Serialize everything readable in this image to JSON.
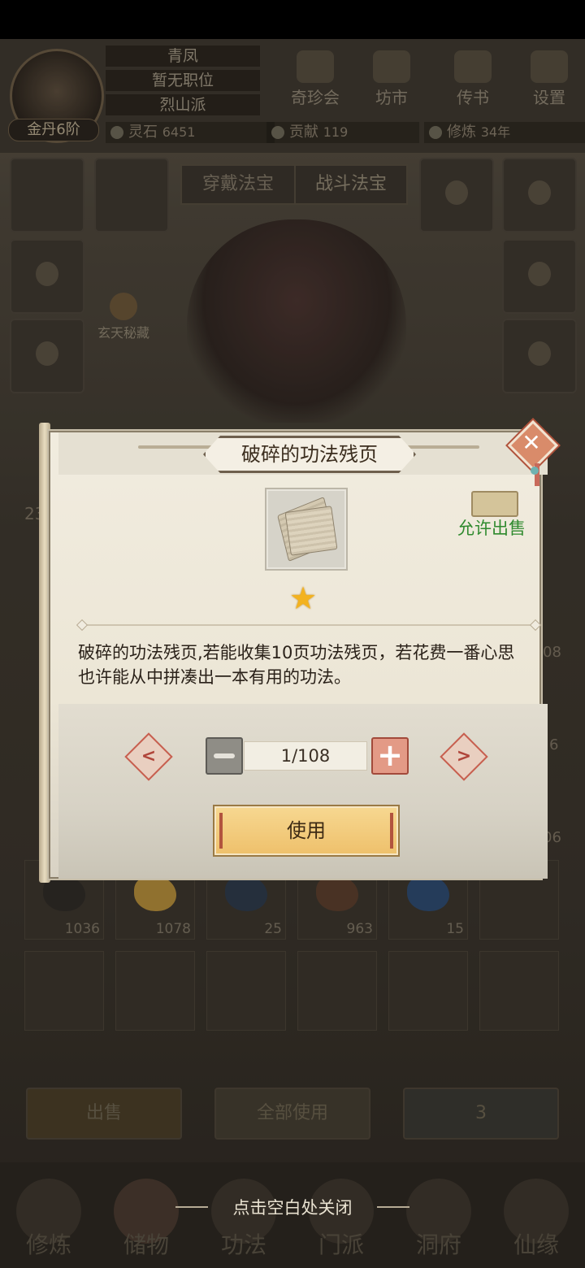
{
  "player": {
    "name": "青凤",
    "position": "暂无职位",
    "sect": "烈山派",
    "rank": "金丹6阶"
  },
  "top_menu": [
    {
      "label": "奇珍会",
      "icon": "treasure-pavilion-icon"
    },
    {
      "label": "坊市",
      "icon": "market-icon"
    },
    {
      "label": "传书",
      "icon": "scroll-letter-icon"
    },
    {
      "label": "设置",
      "icon": "gear-icon"
    }
  ],
  "resources": {
    "spirit_stone_label": "灵石",
    "spirit_stone_value": "6451",
    "contribution_label": "贡献",
    "contribution_value": "119",
    "cultivation_label": "修炼",
    "cultivation_value": "34年"
  },
  "tabs": {
    "wear": "穿戴法宝",
    "battle": "战斗法宝"
  },
  "side_label": "玄天秘藏",
  "inventory_row": [
    {
      "count": "1036",
      "color": "#2f2b27"
    },
    {
      "count": "1078",
      "color": "#b08a3a"
    },
    {
      "count": "25",
      "color": "#2e3a4a"
    },
    {
      "count": "963",
      "color": "#5a3e2c"
    },
    {
      "count": "15",
      "color": "#2e4a6e"
    }
  ],
  "partial_numbers": {
    "left": "23",
    "right_1": "08",
    "right_2": "6",
    "right_3": "06"
  },
  "bottom_buttons": {
    "sell": "出售",
    "use_all": "全部使用",
    "quantity": "3"
  },
  "bottom_nav": [
    {
      "label": "修炼"
    },
    {
      "label": "储物"
    },
    {
      "label": "功法"
    },
    {
      "label": "门派"
    },
    {
      "label": "洞府"
    },
    {
      "label": "仙缘"
    }
  ],
  "modal": {
    "title": "破碎的功法残页",
    "sell_status": "允许出售",
    "description": "破碎的功法残页,若能收集10页功法残页，若花费一番心思也许能从中拼凑出一本有用的功法。",
    "quantity": "1/108",
    "use_button": "使用",
    "stars": 1,
    "star_color": "#f3b21f"
  },
  "close_hint": "点击空白处关闭"
}
